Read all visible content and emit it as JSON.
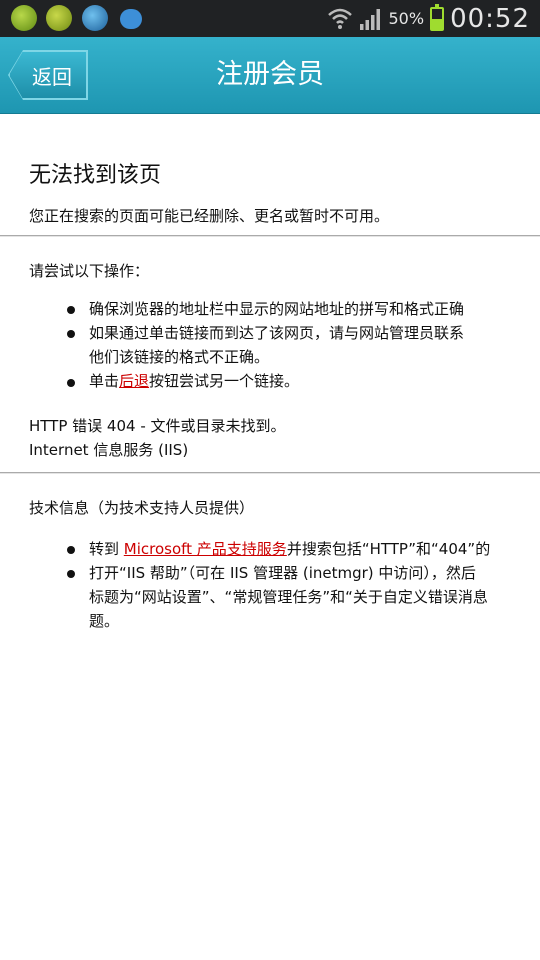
{
  "status_bar": {
    "battery_percent": "50%",
    "time": "00:52",
    "icons": [
      "app-icon-green-plus",
      "app-icon-green-check",
      "app-icon-blue-q",
      "chat-bubble-icon",
      "wifi-icon",
      "signal-icon",
      "battery-icon"
    ]
  },
  "header": {
    "back_label": "返回",
    "title": "注册会员"
  },
  "page": {
    "heading": "无法找到该页",
    "intro": "您正在搜索的页面可能已经删除、更名或暂时不可用。",
    "try_label": "请尝试以下操作：",
    "try_items": {
      "item1": "确保浏览器的地址栏中显示的网站地址的拼写和格式正确",
      "item2_line1": "如果通过单击链接而到达了该网页，请与网站管理员联系",
      "item2_line2": "他们该链接的格式不正确。",
      "item3_prefix": "单击",
      "item3_link": "后退",
      "item3_suffix": "按钮尝试另一个链接。"
    },
    "error_line1": "HTTP 错误 404 - 文件或目录未找到。",
    "error_line2": "Internet 信息服务 (IIS)",
    "tech_label": "技术信息（为技术支持人员提供）",
    "tech_items": {
      "item1_prefix": "转到 ",
      "item1_link": "Microsoft 产品支持服务",
      "item1_suffix": "并搜索包括“HTTP”和“404”的",
      "item2_line1": "打开“IIS 帮助”（可在 IIS 管理器 (inetmgr) 中访问），然后",
      "item2_line2": "标题为“网站设置”、“常规管理任务”和“关于自定义错误消息",
      "item2_line3": "题。"
    }
  },
  "colors": {
    "titlebar": "#1e96b1",
    "link": "#cc0000",
    "statusbar": "#202224"
  }
}
